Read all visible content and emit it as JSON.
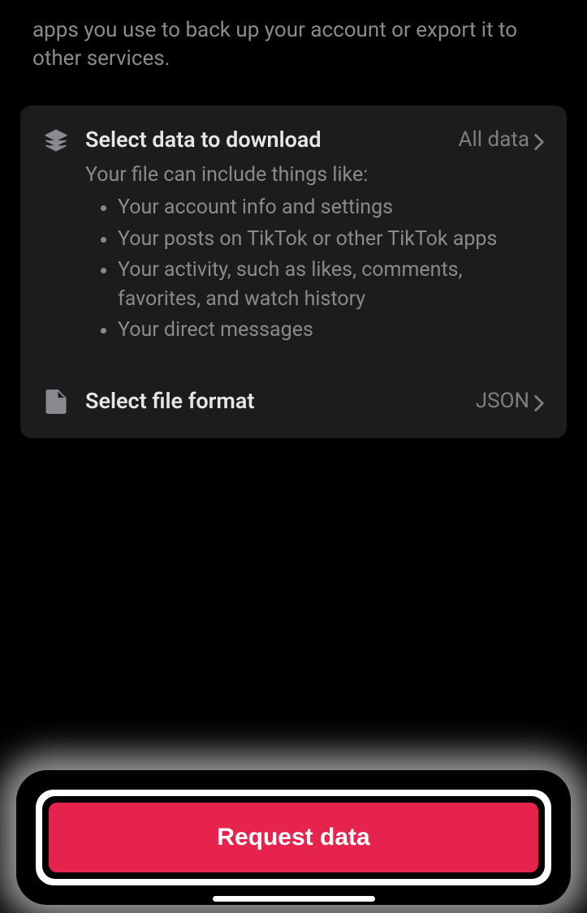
{
  "intro": "apps you use to back up your account or export it to other services.",
  "selectData": {
    "title": "Select data to download",
    "value": "All data",
    "subtitle": "Your file can include things like:",
    "bullets": [
      "Your account info and settings",
      "Your posts on TikTok or other TikTok apps",
      "Your activity, such as likes, comments, favorites, and watch history",
      "Your direct messages"
    ]
  },
  "selectFormat": {
    "title": "Select file format",
    "value": "JSON"
  },
  "requestButton": "Request data"
}
